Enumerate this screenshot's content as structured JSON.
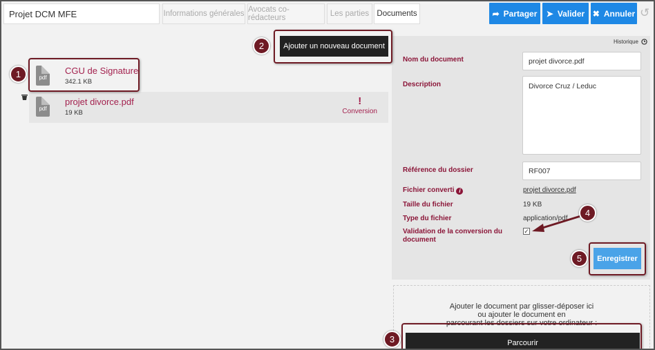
{
  "header": {
    "project_title": "Projet DCM MFE",
    "tabs": [
      "Informations générales",
      "Avocats co-rédacteurs",
      "Les parties",
      "Documents"
    ],
    "share_label": "Partager",
    "validate_label": "Valider",
    "cancel_label": "Annuler"
  },
  "add_document_label": "Ajouter un nouveau document",
  "documents": [
    {
      "name": "CGU de Signature",
      "size": "342.1 KB",
      "icon_text": "pdf"
    },
    {
      "name": "projet divorce.pdf",
      "size": "19 KB",
      "icon_text": "pdf",
      "status_mark": "!",
      "status": "Conversion"
    }
  ],
  "panel": {
    "historique": "Historique",
    "name_label": "Nom du document",
    "name_value": "projet divorce.pdf",
    "description_label": "Description",
    "description_value": "Divorce Cruz / Leduc",
    "reference_label": "Référence du dossier",
    "reference_value": "RF007",
    "converted_label": "Fichier converti",
    "converted_value": "projet divorce.pdf",
    "size_label": "Taille du fichier",
    "size_value": "19 KB",
    "type_label": "Type du fichier",
    "type_value": "application/pdf",
    "validation_label": "Validation de la conversion du document",
    "validation_checked": true,
    "save_label": "Enregistrer"
  },
  "dropzone": {
    "line1": "Ajouter le document par glisser-déposer ici",
    "line2": "ou ajouter le document en",
    "line3": "parcourant les dossiers sur votre ordinateur :",
    "browse_label": "Parcourir"
  },
  "annotations": [
    "1",
    "2",
    "3",
    "4",
    "5"
  ],
  "colors": {
    "accent": "#1e88e5",
    "brand": "#a3214e",
    "annotation": "#6e1a24"
  }
}
